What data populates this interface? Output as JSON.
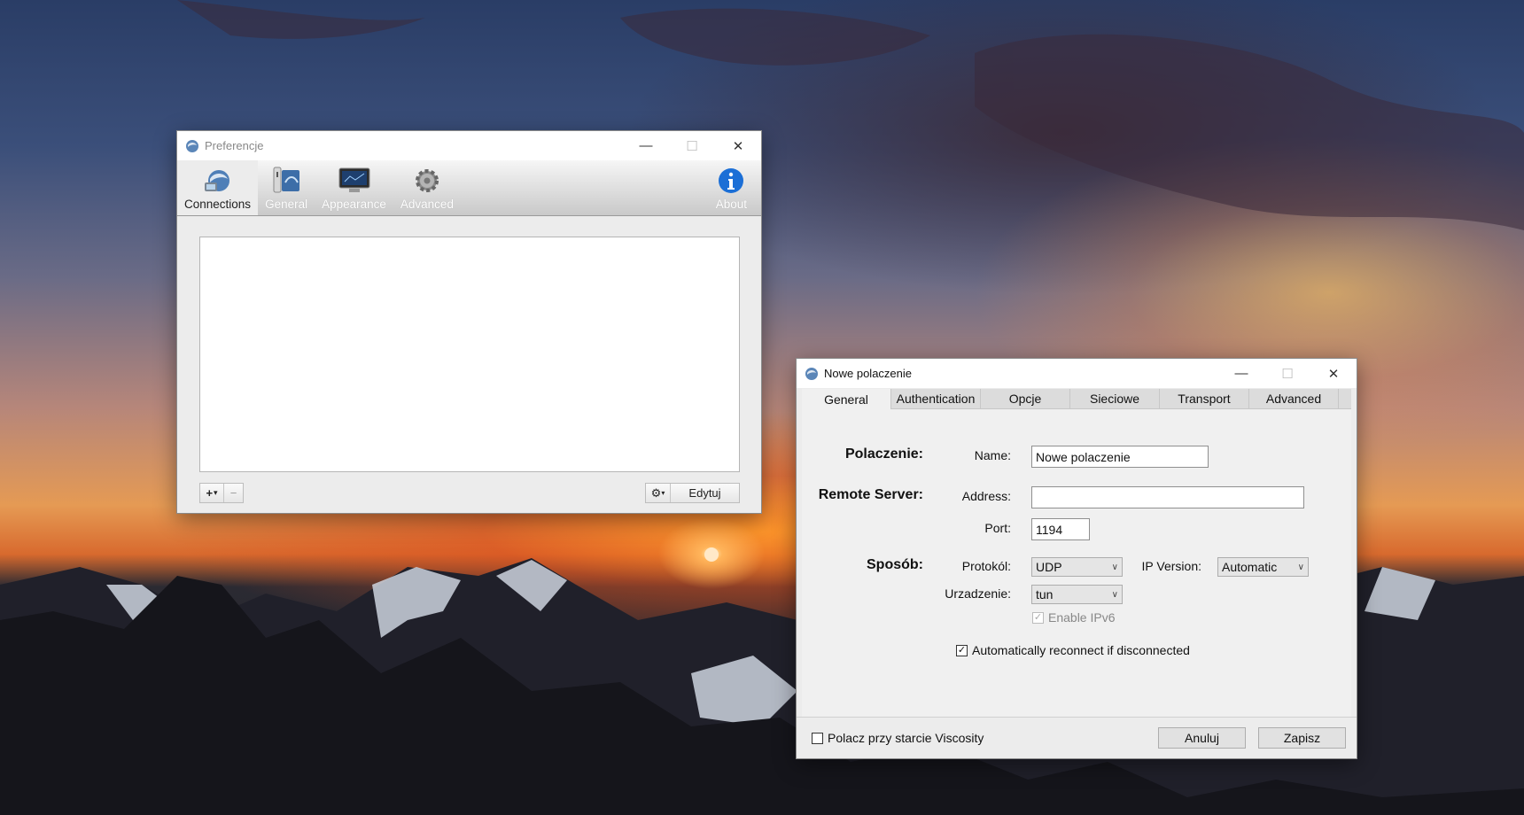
{
  "prefs": {
    "title": "Preferencje",
    "toolbar": {
      "connections": "Connections",
      "general": "General",
      "appearance": "Appearance",
      "advanced": "Advanced",
      "about": "About"
    },
    "add_label": "+",
    "add_menu": "▾",
    "remove_label": "−",
    "gear_label": "⚙",
    "gear_menu": "▾",
    "edit_label": "Edytuj"
  },
  "newconn": {
    "title": "Nowe polaczenie",
    "tabs": [
      "General",
      "Authentication",
      "Opcje",
      "Sieciowe",
      "Transport",
      "Advanced"
    ],
    "sections": {
      "connection": "Polaczenie:",
      "remote": "Remote Server:",
      "method": "Sposób:"
    },
    "labels": {
      "name": "Name:",
      "address": "Address:",
      "port": "Port:",
      "protocol": "Protokól:",
      "ipversion": "IP Version:",
      "device": "Urzadzenie:"
    },
    "values": {
      "name": "Nowe polaczenie",
      "address": "",
      "port": "1194",
      "protocol": "UDP",
      "ipversion": "Automatic",
      "device": "tun"
    },
    "enable_ipv6": "Enable IPv6",
    "auto_reconnect": "Automatically reconnect if disconnected",
    "connect_on_start": "Polacz przy starcie Viscosity",
    "cancel": "Anuluj",
    "save": "Zapisz"
  },
  "window_controls": {
    "minimize": "—",
    "maximize": "☐",
    "close": "✕"
  }
}
